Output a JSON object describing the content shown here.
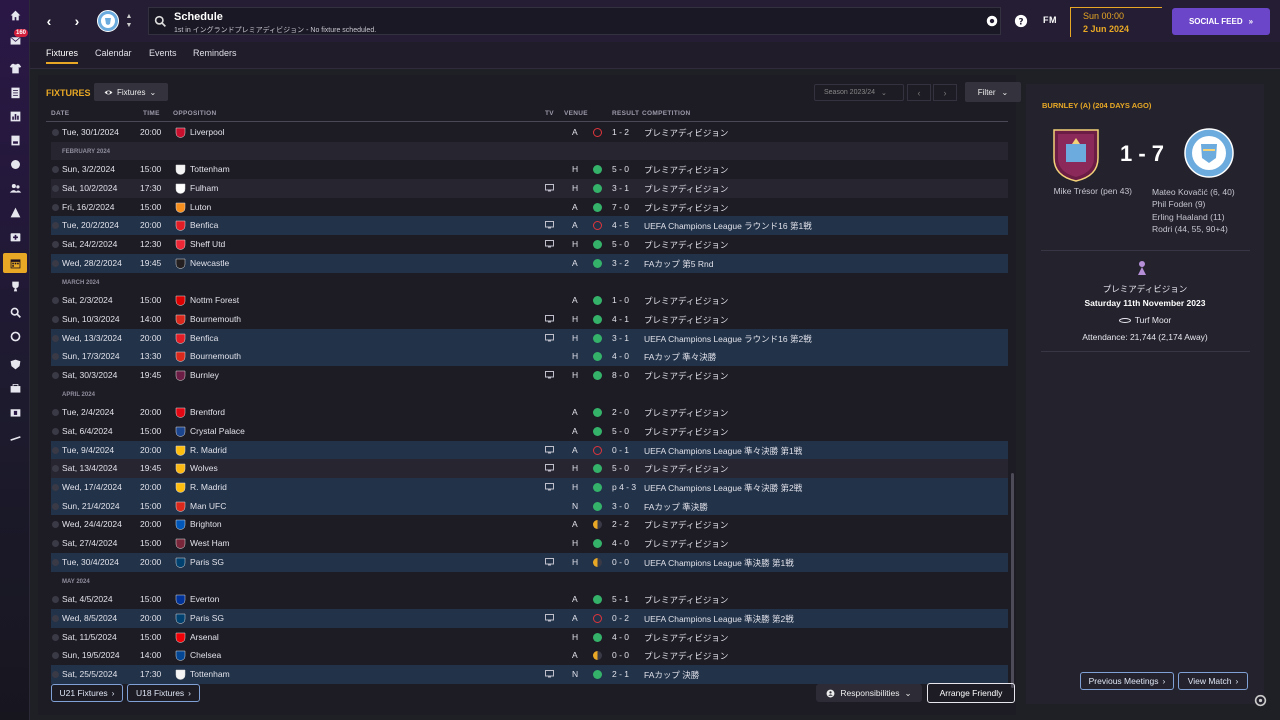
{
  "sidebar": {
    "inbox_badge": "160",
    "items": [
      {
        "icon": "home-icon"
      },
      {
        "icon": "inbox-icon"
      },
      {
        "icon": "squad-shirt-icon"
      },
      {
        "icon": "tactics-clipboard-icon"
      },
      {
        "icon": "data-hub-icon"
      },
      {
        "icon": "report-icon"
      },
      {
        "icon": "dynamics-icon"
      },
      {
        "icon": "staff-icon"
      },
      {
        "icon": "training-icon"
      },
      {
        "icon": "medical-icon"
      },
      {
        "icon": "schedule-calendar-icon"
      },
      {
        "icon": "competitions-trophy-icon"
      },
      {
        "icon": "scouting-search-icon"
      },
      {
        "icon": "transfers-icon"
      },
      {
        "icon": "club-info-shield-icon"
      },
      {
        "icon": "finances-icon"
      },
      {
        "icon": "dev-centre-icon"
      },
      {
        "icon": "more-icon"
      }
    ]
  },
  "topbar": {
    "title": "Schedule",
    "subtitle": "1st in イングランドプレミアディビジョン - No fixture scheduled.",
    "fm_logo": "FM",
    "time": "Sun 00:00",
    "date": "2 Jun 2024",
    "social_label": "SOCIAL FEED",
    "social_arrow": "»"
  },
  "tabs": [
    "Fixtures",
    "Calendar",
    "Events",
    "Reminders"
  ],
  "fixtures": {
    "title": "FIXTURES",
    "view_dropdown": "Fixtures",
    "season": "Season 2023/24",
    "filter": "Filter",
    "columns": {
      "date": "DATE",
      "time": "TIME",
      "opposition": "OPPOSITION",
      "tv": "TV",
      "venue": "VENUE",
      "result": "RESULT",
      "competition": "COMPETITION"
    },
    "rows": [
      {
        "kind": "match",
        "style": "",
        "date": "Tue, 30/1/2024",
        "time": "20:00",
        "opp": "Liverpool",
        "crest": "#c8102e",
        "tv": false,
        "venue": "A",
        "res": "L",
        "score": "1 - 2",
        "comp": "プレミアディビジョン"
      },
      {
        "kind": "month",
        "style": "alt",
        "label": "FEBRUARY 2024"
      },
      {
        "kind": "match",
        "style": "",
        "date": "Sun, 3/2/2024",
        "time": "15:00",
        "opp": "Tottenham",
        "crest": "#f4f4f4",
        "tv": false,
        "venue": "H",
        "res": "W",
        "score": "5 - 0",
        "comp": "プレミアディビジョン"
      },
      {
        "kind": "match",
        "style": "alt",
        "date": "Sat, 10/2/2024",
        "time": "17:30",
        "opp": "Fulham",
        "crest": "#ffffff",
        "tv": true,
        "venue": "H",
        "res": "W",
        "score": "3 - 1",
        "comp": "プレミアディビジョン"
      },
      {
        "kind": "match",
        "style": "",
        "date": "Fri, 16/2/2024",
        "time": "15:00",
        "opp": "Luton",
        "crest": "#f78f1e",
        "tv": false,
        "venue": "A",
        "res": "W",
        "score": "7 - 0",
        "comp": "プレミアディビジョン"
      },
      {
        "kind": "match",
        "style": "hl",
        "date": "Tue, 20/2/2024",
        "time": "20:00",
        "opp": "Benfica",
        "crest": "#e21d26",
        "tv": true,
        "venue": "A",
        "res": "L",
        "score": "4 - 5",
        "comp": "UEFA Champions League ラウンド16 第1戦"
      },
      {
        "kind": "match",
        "style": "",
        "date": "Sat, 24/2/2024",
        "time": "12:30",
        "opp": "Sheff Utd",
        "crest": "#ee2737",
        "tv": true,
        "venue": "H",
        "res": "W",
        "score": "5 - 0",
        "comp": "プレミアディビジョン"
      },
      {
        "kind": "match",
        "style": "hl",
        "date": "Wed, 28/2/2024",
        "time": "19:45",
        "opp": "Newcastle",
        "crest": "#241f20",
        "tv": false,
        "venue": "A",
        "res": "W",
        "score": "3 - 2",
        "comp": "FAカップ 第5 Rnd"
      },
      {
        "kind": "month",
        "style": "",
        "label": "MARCH 2024"
      },
      {
        "kind": "match",
        "style": "",
        "date": "Sat, 2/3/2024",
        "time": "15:00",
        "opp": "Nottm Forest",
        "crest": "#dd0000",
        "tv": false,
        "venue": "A",
        "res": "W",
        "score": "1 - 0",
        "comp": "プレミアディビジョン"
      },
      {
        "kind": "match",
        "style": "",
        "date": "Sun, 10/3/2024",
        "time": "14:00",
        "opp": "Bournemouth",
        "crest": "#da291c",
        "tv": true,
        "venue": "H",
        "res": "W",
        "score": "4 - 1",
        "comp": "プレミアディビジョン"
      },
      {
        "kind": "match",
        "style": "hl",
        "date": "Wed, 13/3/2024",
        "time": "20:00",
        "opp": "Benfica",
        "crest": "#e21d26",
        "tv": true,
        "venue": "H",
        "res": "W",
        "score": "3 - 1",
        "comp": "UEFA Champions League ラウンド16 第2戦"
      },
      {
        "kind": "match",
        "style": "hl",
        "date": "Sun, 17/3/2024",
        "time": "13:30",
        "opp": "Bournemouth",
        "crest": "#da291c",
        "tv": false,
        "venue": "H",
        "res": "W",
        "score": "4 - 0",
        "comp": "FAカップ 準々決勝"
      },
      {
        "kind": "match",
        "style": "",
        "date": "Sat, 30/3/2024",
        "time": "19:45",
        "opp": "Burnley",
        "crest": "#6c1d45",
        "tv": true,
        "venue": "H",
        "res": "W",
        "score": "8 - 0",
        "comp": "プレミアディビジョン"
      },
      {
        "kind": "month",
        "style": "",
        "label": "APRIL 2024"
      },
      {
        "kind": "match",
        "style": "",
        "date": "Tue, 2/4/2024",
        "time": "20:00",
        "opp": "Brentford",
        "crest": "#e30613",
        "tv": false,
        "venue": "A",
        "res": "W",
        "score": "2 - 0",
        "comp": "プレミアディビジョン"
      },
      {
        "kind": "match",
        "style": "",
        "date": "Sat, 6/4/2024",
        "time": "15:00",
        "opp": "Crystal Palace",
        "crest": "#1b458f",
        "tv": false,
        "venue": "A",
        "res": "W",
        "score": "5 - 0",
        "comp": "プレミアディビジョン"
      },
      {
        "kind": "match",
        "style": "hl",
        "date": "Tue, 9/4/2024",
        "time": "20:00",
        "opp": "R. Madrid",
        "crest": "#febe10",
        "tv": true,
        "venue": "A",
        "res": "L",
        "score": "0 - 1",
        "comp": "UEFA Champions League 準々決勝 第1戦"
      },
      {
        "kind": "match",
        "style": "alt",
        "date": "Sat, 13/4/2024",
        "time": "19:45",
        "opp": "Wolves",
        "crest": "#fdb913",
        "tv": true,
        "venue": "H",
        "res": "W",
        "score": "5 - 0",
        "comp": "プレミアディビジョン"
      },
      {
        "kind": "match",
        "style": "hl",
        "date": "Wed, 17/4/2024",
        "time": "20:00",
        "opp": "R. Madrid",
        "crest": "#febe10",
        "tv": true,
        "venue": "H",
        "res": "W",
        "score": "p 4 - 3",
        "comp": "UEFA Champions League 準々決勝 第2戦"
      },
      {
        "kind": "match",
        "style": "hl",
        "date": "Sun, 21/4/2024",
        "time": "15:00",
        "opp": "Man UFC",
        "crest": "#da291c",
        "tv": false,
        "venue": "N",
        "res": "W",
        "score": "3 - 0",
        "comp": "FAカップ 準決勝"
      },
      {
        "kind": "match",
        "style": "",
        "date": "Wed, 24/4/2024",
        "time": "20:00",
        "opp": "Brighton",
        "crest": "#0057b8",
        "tv": false,
        "venue": "A",
        "res": "D",
        "score": "2 - 2",
        "comp": "プレミアディビジョン"
      },
      {
        "kind": "match",
        "style": "",
        "date": "Sat, 27/4/2024",
        "time": "15:00",
        "opp": "West Ham",
        "crest": "#7a263a",
        "tv": false,
        "venue": "H",
        "res": "W",
        "score": "4 - 0",
        "comp": "プレミアディビジョン"
      },
      {
        "kind": "match",
        "style": "hl",
        "date": "Tue, 30/4/2024",
        "time": "20:00",
        "opp": "Paris SG",
        "crest": "#004170",
        "tv": true,
        "venue": "H",
        "res": "D",
        "score": "0 - 0",
        "comp": "UEFA Champions League 準決勝 第1戦"
      },
      {
        "kind": "month",
        "style": "",
        "label": "MAY 2024"
      },
      {
        "kind": "match",
        "style": "",
        "date": "Sat, 4/5/2024",
        "time": "15:00",
        "opp": "Everton",
        "crest": "#003399",
        "tv": false,
        "venue": "A",
        "res": "W",
        "score": "5 - 1",
        "comp": "プレミアディビジョン"
      },
      {
        "kind": "match",
        "style": "hl",
        "date": "Wed, 8/5/2024",
        "time": "20:00",
        "opp": "Paris SG",
        "crest": "#004170",
        "tv": true,
        "venue": "A",
        "res": "L",
        "score": "0 - 2",
        "comp": "UEFA Champions League 準決勝 第2戦"
      },
      {
        "kind": "match",
        "style": "",
        "date": "Sat, 11/5/2024",
        "time": "15:00",
        "opp": "Arsenal",
        "crest": "#ef0107",
        "tv": false,
        "venue": "H",
        "res": "W",
        "score": "4 - 0",
        "comp": "プレミアディビジョン"
      },
      {
        "kind": "match",
        "style": "",
        "date": "Sun, 19/5/2024",
        "time": "14:00",
        "opp": "Chelsea",
        "crest": "#034694",
        "tv": false,
        "venue": "A",
        "res": "D",
        "score": "0 - 0",
        "comp": "プレミアディビジョン"
      },
      {
        "kind": "match",
        "style": "hl",
        "date": "Sat, 25/5/2024",
        "time": "17:30",
        "opp": "Tottenham",
        "crest": "#f4f4f4",
        "tv": true,
        "venue": "N",
        "res": "W",
        "score": "2 - 1",
        "comp": "FAカップ 決勝"
      }
    ],
    "result_colors": {
      "W": "#35b26a",
      "L": "#e0353b",
      "D": "#e8a825"
    }
  },
  "bottom": {
    "u21": "U21 Fixtures",
    "u18": "U18 Fixtures",
    "responsibilities": "Responsibilities",
    "arrange": "Arrange Friendly"
  },
  "last_match": {
    "title": "BURNLEY (A) (204 DAYS AGO)",
    "score": "1 - 7",
    "home_scorers": "Mike Trésor (pen 43)",
    "away_scorers": [
      "Mateo Kovačić (6, 40)",
      "Phil Foden (9)",
      "Erling Haaland (11)",
      "Rodri (44, 55, 90+4)"
    ],
    "competition": "プレミアディビジョン",
    "date": "Saturday 11th November 2023",
    "venue": "Turf Moor",
    "attendance": "Attendance: 21,744 (2,174 Away)",
    "prev_btn": "Previous Meetings",
    "view_btn": "View Match"
  },
  "colors": {
    "accent": "#e8a825",
    "social": "#6b46c9",
    "mancity": "#6cabdd",
    "burnley": "#6c1d45"
  }
}
